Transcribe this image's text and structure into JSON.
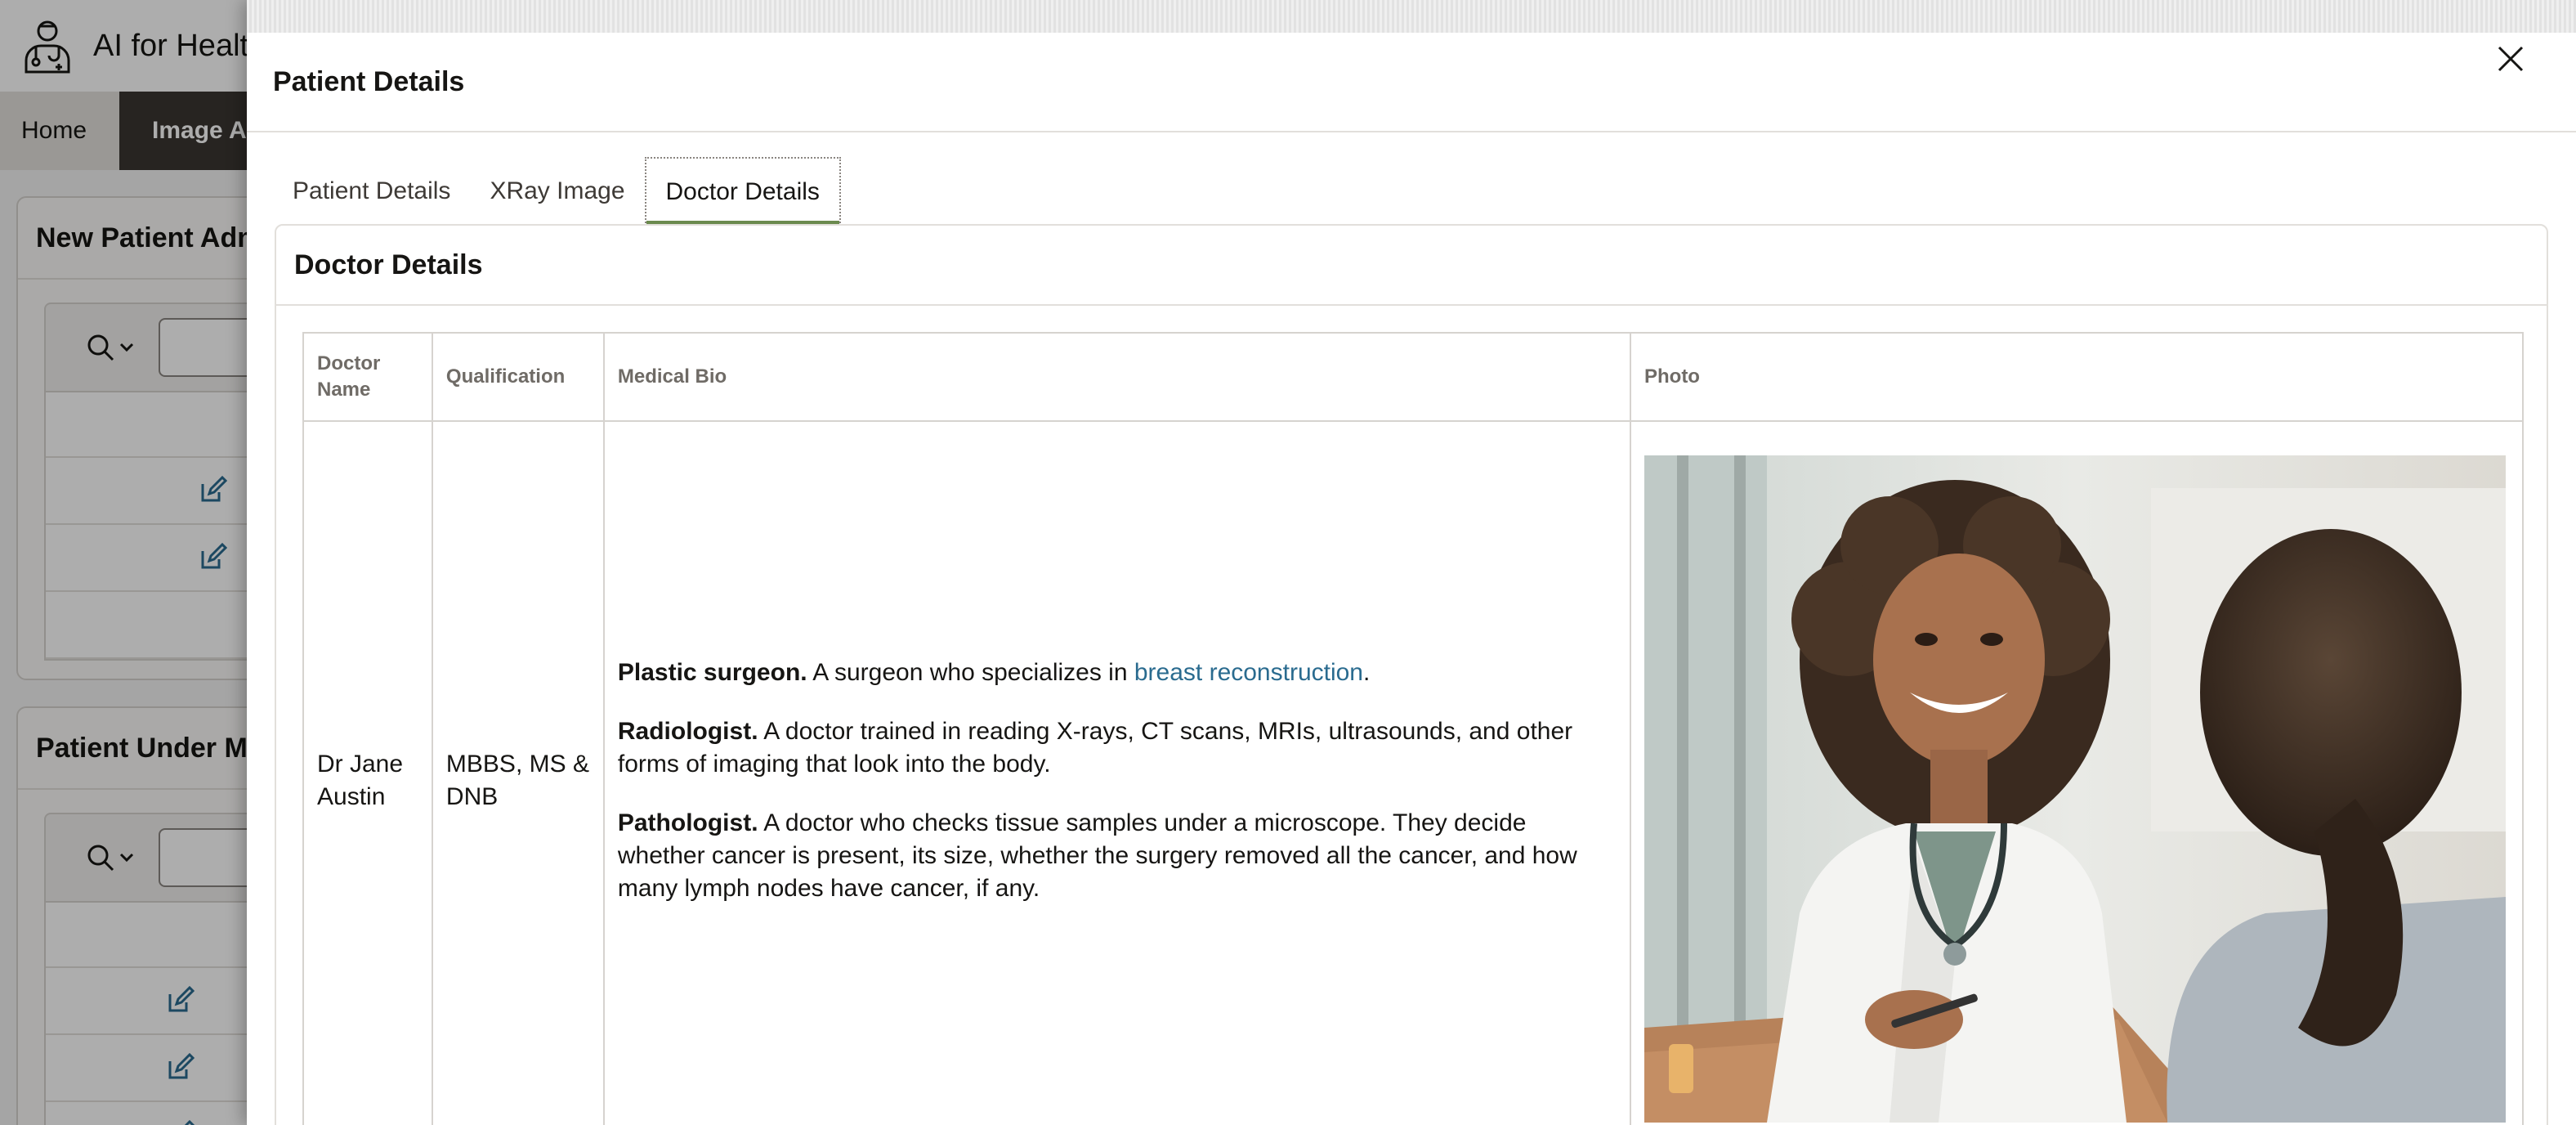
{
  "app": {
    "title": "AI for Healt",
    "nav": [
      "Home",
      "Image An"
    ]
  },
  "regions": [
    {
      "title": "New Patient Adm"
    },
    {
      "title": "Patient Under Me"
    }
  ],
  "dialog": {
    "title": "Patient Details",
    "tabs": [
      "Patient Details",
      "XRay Image",
      "Doctor Details"
    ],
    "active_tab": "Doctor Details",
    "card_title": "Doctor Details",
    "table": {
      "headers": {
        "name": "Doctor Name",
        "qualification": "Qualification",
        "bio": "Medical Bio",
        "photo": "Photo"
      },
      "rows": [
        {
          "name": "Dr Jane Austin",
          "qualification": "MBBS, MS & DNB",
          "bio": [
            {
              "term": "Plastic surgeon.",
              "text_before": " A surgeon who specializes in ",
              "link": "breast reconstruction",
              "text_after": "."
            },
            {
              "term": "Radiologist.",
              "text": " A doctor trained in reading X-rays, CT scans, MRIs, ultrasounds, and other forms of imaging that look into the body."
            },
            {
              "term": "Pathologist.",
              "text": " A doctor who checks tissue samples under a microscope. They decide whether cancer is present, its size, whether the surgery removed all the cancer, and how many lymph nodes have cancer, if any."
            }
          ]
        }
      ]
    }
  },
  "colors": {
    "active_tab_underline": "#6b8a4e",
    "link": "#2a6b8f",
    "nav_active_bg": "#3a3631"
  },
  "icons": [
    "doctor-logo-icon",
    "search-icon",
    "chevron-down-icon",
    "edit-icon",
    "close-icon"
  ]
}
